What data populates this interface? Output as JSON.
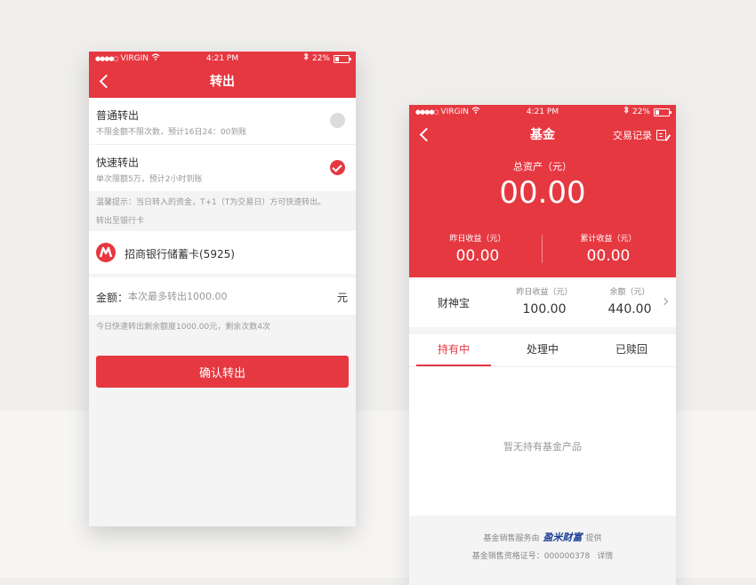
{
  "status": {
    "carrier": "VIRGIN",
    "time": "4:21 PM",
    "battery": "22%"
  },
  "transfer_screen": {
    "title": "转出",
    "options": [
      {
        "title": "普通转出",
        "desc": "不限金额不限次数，预计16日24：00到账",
        "selected": false
      },
      {
        "title": "快速转出",
        "desc": "单次限额5万，预计2小时到账",
        "selected": true
      }
    ],
    "tip": "温馨提示：当日转入的资金，T+1（T为交易日）方可快速转出。",
    "to_bank_label": "转出至银行卡",
    "bank_name": "招商银行储蓄卡(5925)",
    "amount_label": "金额：",
    "amount_placeholder": "本次最多转出1000.00",
    "amount_unit": "元",
    "quota_note": "今日快速转出剩余额度1000.00元，剩余次数4次",
    "confirm_label": "确认转出"
  },
  "fund_screen": {
    "title": "基金",
    "trade_record": "交易记录",
    "total_assets_label": "总资产（元）",
    "total_assets_value": "00.00",
    "yesterday_label": "昨日收益（元）",
    "yesterday_value": "00.00",
    "cumulative_label": "累计收益（元）",
    "cumulative_value": "00.00",
    "product": {
      "name": "财神宝",
      "yesterday_label": "昨日收益（元）",
      "yesterday_value": "100.00",
      "balance_label": "余额（元）",
      "balance_value": "440.00"
    },
    "tabs": [
      "持有中",
      "处理中",
      "已赎回"
    ],
    "active_tab": 0,
    "empty_text": "暂无持有基金产品",
    "footer": {
      "provider_prefix": "基金销售服务由",
      "provider_brand": "盈米财富",
      "provider_suffix": "提供",
      "license": "基金销售资格证号：000000378",
      "details": "详情"
    }
  },
  "colors": {
    "accent": "#e63841",
    "brand_blue": "#1c3f95"
  }
}
